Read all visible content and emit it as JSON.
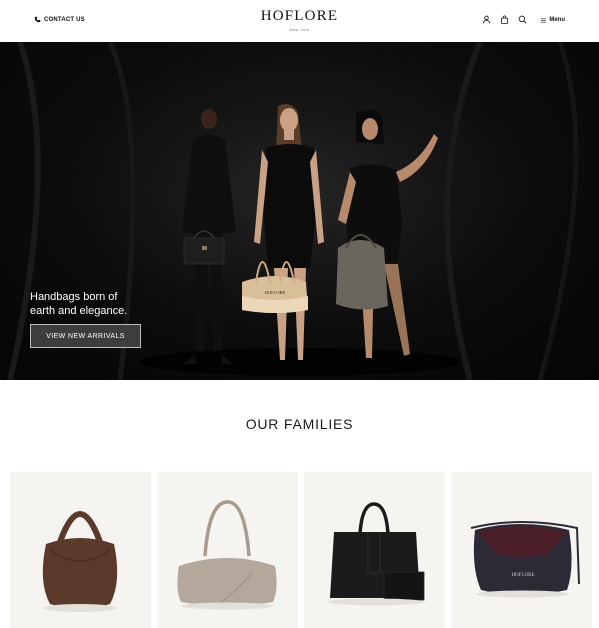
{
  "header": {
    "contact_label": "CONTACT US",
    "brand_name": "HOFLORE",
    "brand_city": "New York",
    "menu_label": "Menu",
    "icons": [
      "phone-icon",
      "user-icon",
      "bag-icon",
      "search-icon",
      "menu-icon"
    ]
  },
  "hero": {
    "headline_line1": "Handbags born of",
    "headline_line2": "earth and elegance.",
    "cta_label": "VIEW NEW ARRIVALS",
    "bag_brand_mark": "HOFLORE"
  },
  "families": {
    "title": "OUR FAMILIES",
    "items": [
      {
        "color": "#5a3a2a",
        "icon": "brown-hobo-bag"
      },
      {
        "color": "#b4a89c",
        "icon": "taupe-shoulder-bag"
      },
      {
        "color": "#1b1b1b",
        "icon": "black-tote-bag"
      },
      {
        "color": "#2d2a35",
        "icon": "navy-burgundy-crossbody-bag",
        "mark": "HOFLORE"
      }
    ]
  },
  "colors": {
    "accent": "#111111",
    "hero_bg": "#0c0c0c",
    "card_bg": "#f5f4f1"
  }
}
